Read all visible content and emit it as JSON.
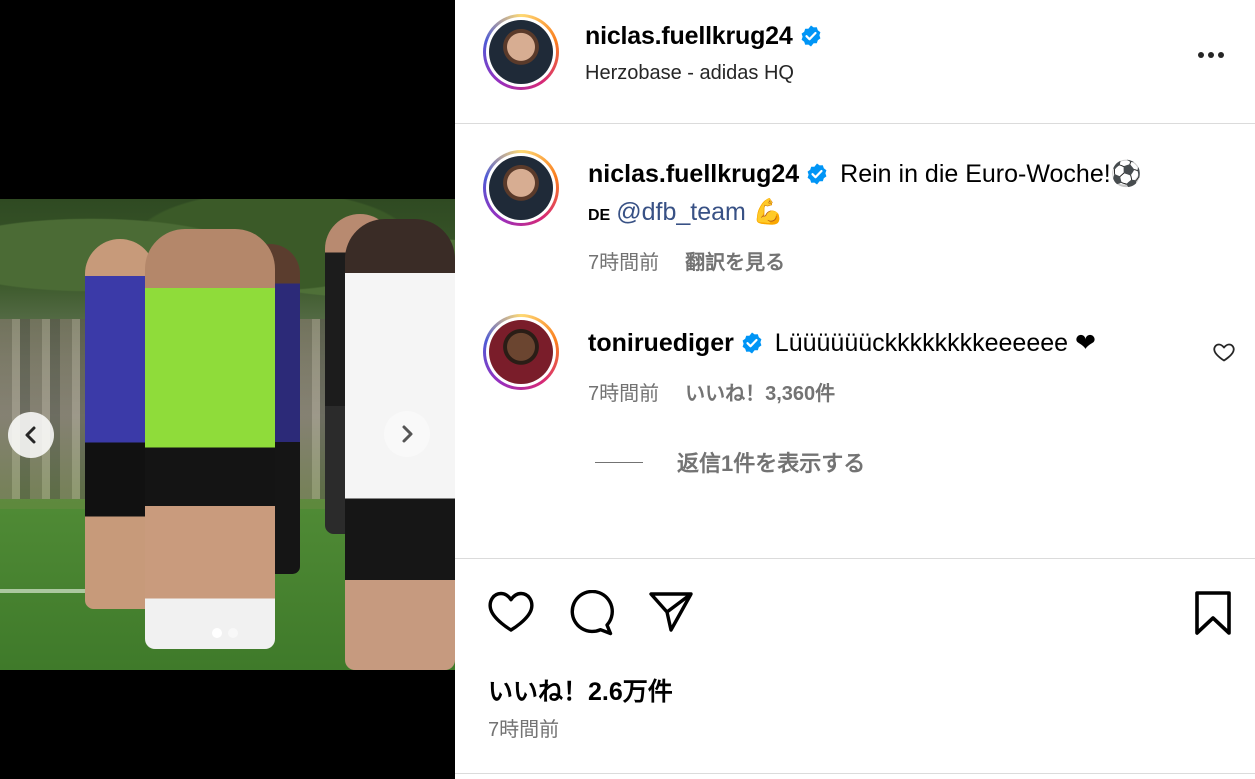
{
  "post": {
    "username": "niclas.fuellkrug24",
    "location": "Herzobase - adidas HQ",
    "caption": {
      "username": "niclas.fuellkrug24",
      "text": "Rein in die Euro-Woche!⚽",
      "flag": "DE",
      "mention": "@dfb_team",
      "emoji": "💪",
      "time": "7時間前",
      "translate_label": "翻訳を見る"
    },
    "comment": {
      "username": "toniruediger",
      "text": "Lüüüüüückkkkkkkkeeeeee ❤",
      "time": "7時間前",
      "likes": "いいね！3,360件",
      "replies": "返信1件を表示する"
    },
    "likes_total": "いいね！2.6万件",
    "time": "7時間前",
    "carousel": {
      "current": 1,
      "total": 2
    }
  },
  "icons": {
    "verified": "verified-badge-icon",
    "more": "more-options-icon",
    "like": "heart-icon",
    "comment": "comment-bubble-icon",
    "share": "paper-plane-icon",
    "save": "bookmark-icon",
    "prev": "chevron-left-icon",
    "next": "chevron-right-icon"
  },
  "colors": {
    "verified": "#0095f6",
    "mention": "#385185",
    "meta": "#737373"
  }
}
